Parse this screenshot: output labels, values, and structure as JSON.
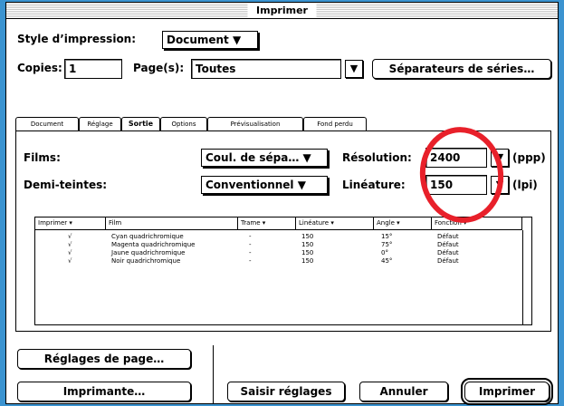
{
  "window": {
    "title": "Imprimer"
  },
  "style": {
    "label": "Style d’impression:",
    "value": "Document"
  },
  "copies": {
    "label": "Copies:",
    "value": "1"
  },
  "pages": {
    "label": "Page(s):",
    "value": "Toutes"
  },
  "separators_button": "Séparateurs de séries…",
  "tabs": [
    "Document",
    "Réglage",
    "Sortie",
    "Options",
    "Prévisualisation",
    "Fond perdu"
  ],
  "active_tab": "Sortie",
  "films": {
    "label": "Films:",
    "value": "Coul. de sépa…"
  },
  "halftone": {
    "label": "Demi-teintes:",
    "value": "Conventionnel"
  },
  "resolution": {
    "label": "Résolution:",
    "value": "2400",
    "unit": "(ppp)"
  },
  "lineature": {
    "label": "Linéature:",
    "value": "150",
    "unit": "(lpi)"
  },
  "table": {
    "headers": [
      "Imprimer",
      "Film",
      "Trame",
      "Linéature",
      "Angle",
      "Fonction"
    ],
    "rows": [
      {
        "print": "√",
        "film": "Cyan quadrichromique",
        "trame": "-",
        "lineature": "150",
        "angle": "15°",
        "fonction": "Défaut"
      },
      {
        "print": "√",
        "film": "Magenta quadrichromique",
        "trame": "-",
        "lineature": "150",
        "angle": "75°",
        "fonction": "Défaut"
      },
      {
        "print": "√",
        "film": "Jaune quadrichromique",
        "trame": "-",
        "lineature": "150",
        "angle": "0°",
        "fonction": "Défaut"
      },
      {
        "print": "√",
        "film": "Noir quadrichromique",
        "trame": "-",
        "lineature": "150",
        "angle": "45°",
        "fonction": "Défaut"
      }
    ]
  },
  "buttons": {
    "page_setup": "Réglages de page…",
    "printer": "Imprimante…",
    "capture": "Saisir réglages",
    "cancel": "Annuler",
    "print": "Imprimer"
  },
  "colors": {
    "desktop": "#3b93d0",
    "annotation": "#e8202a"
  },
  "icons": {
    "dropdown": "triangle-down-icon"
  }
}
